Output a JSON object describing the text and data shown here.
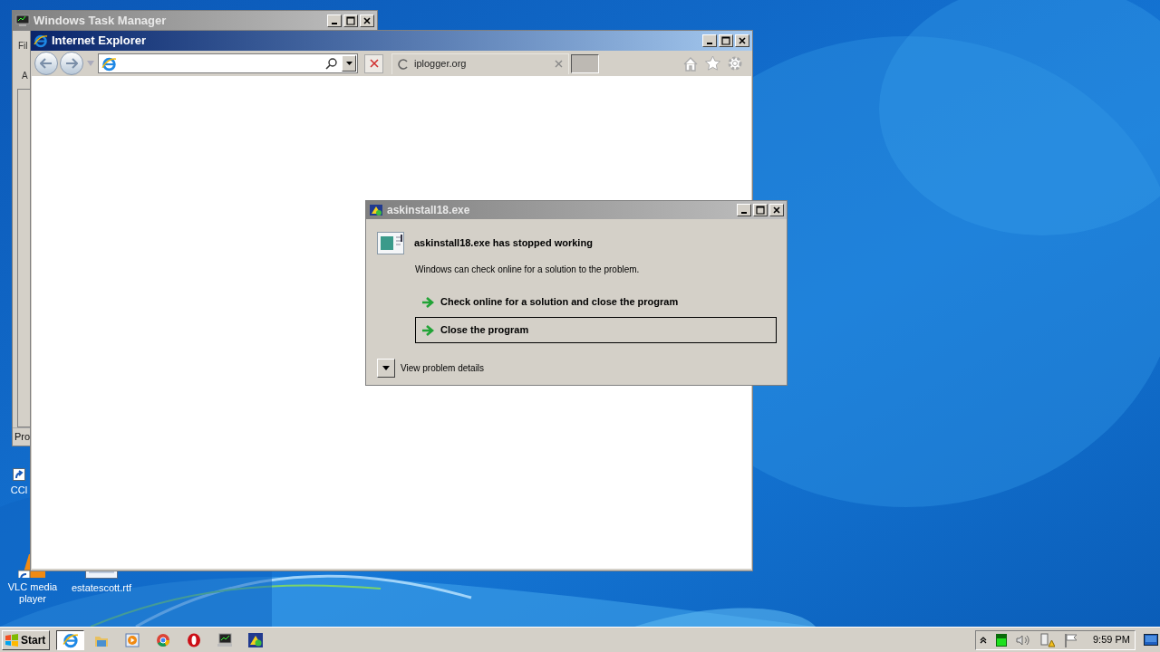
{
  "desktop_icons": [
    {
      "label": "CCl"
    },
    {
      "label": "VLC media player"
    },
    {
      "label": "estatescott.rtf"
    }
  ],
  "task_manager": {
    "title": "Windows Task Manager",
    "menu_text": "Fil",
    "tab_label": "A",
    "status_text": "Pro"
  },
  "browser": {
    "title": "Internet Explorer",
    "tab": {
      "title": "iplogger.org"
    }
  },
  "dialog": {
    "title": "askinstall18.exe",
    "heading": "askinstall18.exe has stopped working",
    "message": "Windows can check online for a solution to the problem.",
    "options": [
      {
        "label": "Check online for a solution and close the program",
        "selected": false
      },
      {
        "label": "Close the program",
        "selected": true
      }
    ],
    "details_label": "View problem details"
  },
  "taskbar": {
    "start_label": "Start",
    "apps": [
      {
        "kind": "ie",
        "selected": true
      },
      {
        "kind": "folder",
        "selected": false
      },
      {
        "kind": "media",
        "selected": false
      },
      {
        "kind": "chrome",
        "selected": false
      },
      {
        "kind": "opera",
        "selected": false
      },
      {
        "kind": "monitor",
        "selected": false
      },
      {
        "kind": "installer",
        "selected": false
      }
    ],
    "clock": "9:59 PM"
  }
}
